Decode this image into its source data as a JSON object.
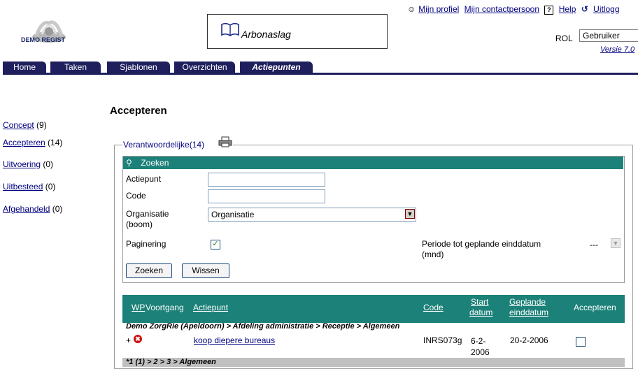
{
  "header": {
    "logo_text": "DEMO REGIST",
    "app_title": "Arbonaslag",
    "links": [
      "Mijn profiel",
      "Mijn contactpersoon",
      "Help",
      "Uitlogg"
    ],
    "rol_label": "ROL",
    "rol_value": "Gebruiker",
    "versie": "Versie 7.0"
  },
  "tabs": [
    {
      "label": "Home"
    },
    {
      "label": "Taken"
    },
    {
      "label": "Sjablonen"
    },
    {
      "label": "Overzichten"
    },
    {
      "label": "Actiepunten"
    }
  ],
  "sidebar": [
    {
      "label": "Concept",
      "count": "(9)"
    },
    {
      "label": "Accepteren",
      "count": "(14)"
    },
    {
      "label": "Uitvoering",
      "count": "(0)"
    },
    {
      "label": "Uitbesteed",
      "count": "(0)"
    },
    {
      "label": "Afgehandeld",
      "count": "(0)"
    }
  ],
  "main": {
    "title": "Accepteren",
    "legend": "Verantwoordelijke(14)",
    "search": {
      "header": "Zoeken",
      "actiepunt_label": "Actiepunt",
      "actiepunt_value": "",
      "code_label": "Code",
      "code_value": "",
      "organisatie_label_1": "Organisatie",
      "organisatie_label_2": "(boom)",
      "organisatie_value": "Organisatie",
      "paginering_label": "Paginering",
      "paginering_checked": true,
      "periode_label": "Periode tot geplande einddatum (mnd)",
      "periode_value": "---",
      "zoeken_button": "Zoeken",
      "wissen_button": "Wissen"
    },
    "table": {
      "headers": {
        "wp": "WP",
        "voortgang": "Voortgang",
        "actiepunt": "Actiepunt",
        "code": "Code",
        "start_1": "Start",
        "start_2": "datum",
        "gepland_1": "Geplande",
        "gepland_2": "einddatum",
        "accepteren": "Accepteren"
      },
      "group_path": "Demo ZorgRie (Apeldoorn) > Afdeling administratie > Receptie > Algemeen",
      "rows": [
        {
          "plus": "+",
          "actiepunt": "koop diepere bureaus",
          "code": "INRS073g",
          "start_1": "6-2-",
          "start_2": "2006",
          "gepland": "20-2-2006"
        }
      ],
      "group2_path": "*1 (1) > 2 > 3 > Algemeen"
    }
  }
}
